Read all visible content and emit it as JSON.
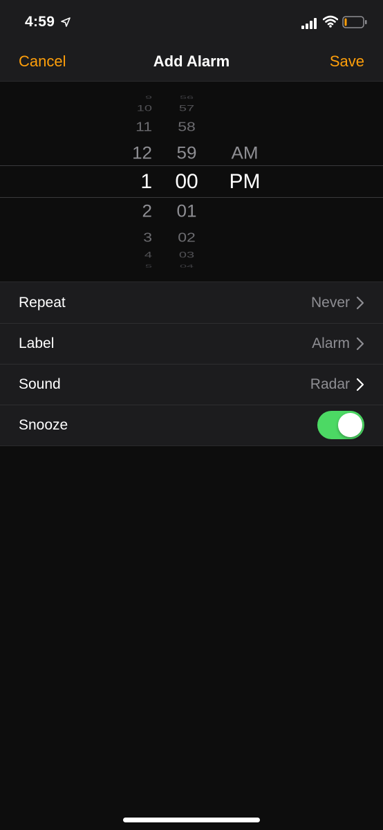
{
  "status_bar": {
    "time": "4:59"
  },
  "nav": {
    "cancel": "Cancel",
    "title": "Add Alarm",
    "save": "Save"
  },
  "picker": {
    "hours": [
      "9",
      "10",
      "11",
      "12",
      "1",
      "2",
      "3",
      "4",
      "5"
    ],
    "minutes": [
      "56",
      "57",
      "58",
      "59",
      "00",
      "01",
      "02",
      "03",
      "04"
    ],
    "ampm": [
      "AM",
      "PM"
    ],
    "selected": {
      "hour": "1",
      "minute": "00",
      "period": "PM"
    }
  },
  "settings": {
    "repeat": {
      "label": "Repeat",
      "value": "Never"
    },
    "label": {
      "label": "Label",
      "value": "Alarm"
    },
    "sound": {
      "label": "Sound",
      "value": "Radar"
    },
    "snooze": {
      "label": "Snooze",
      "on": true
    }
  },
  "colors": {
    "accent": "#ff9f0a",
    "toggle_on": "#4cd964",
    "background": "#0d0d0d",
    "list_bg": "#1c1c1e"
  }
}
